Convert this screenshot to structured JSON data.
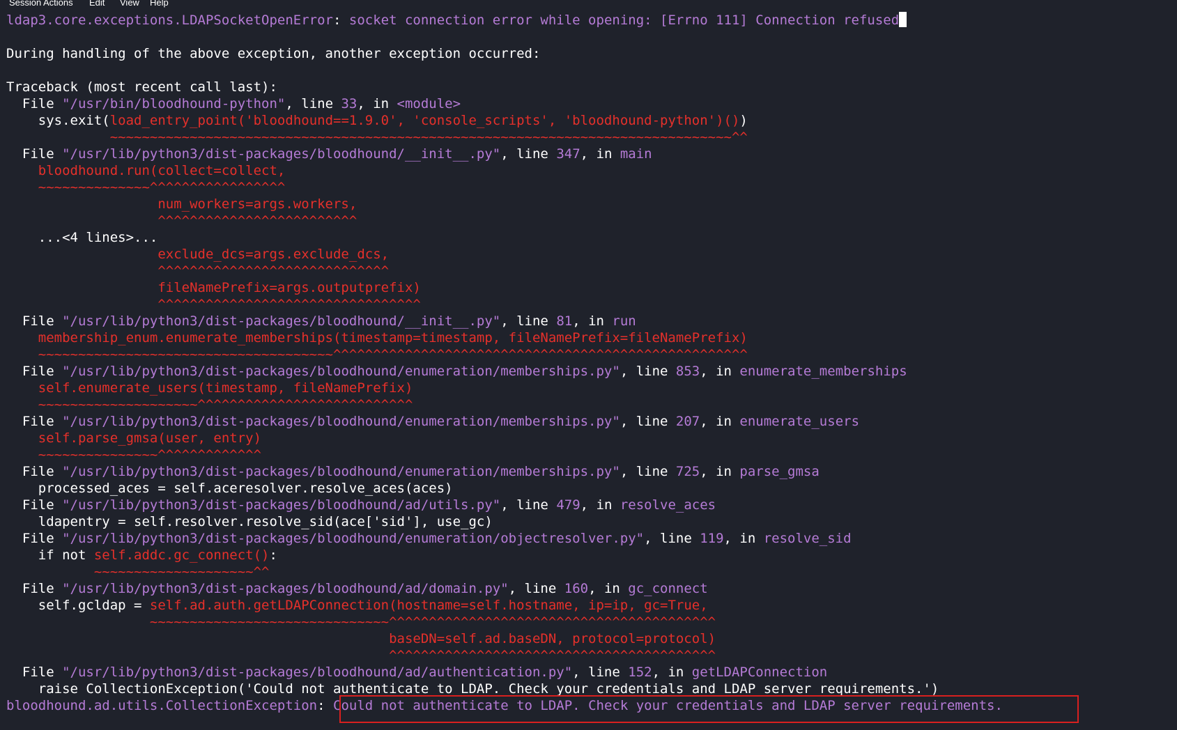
{
  "menubar": {
    "items": [
      "Session",
      "Actions",
      "Edit",
      "View",
      "Help"
    ]
  },
  "lines": [
    [
      [
        "p",
        "ldap3.core.exceptions.LDAPSocketOpenError"
      ],
      [
        "w",
        ": "
      ],
      [
        "p",
        "socket connection error while opening: [Errno 111] Connection refused"
      ]
    ],
    [],
    [
      [
        "w",
        "During handling of the above exception, another exception occurred:"
      ]
    ],
    [],
    [
      [
        "w",
        "Traceback (most recent call last):"
      ]
    ],
    [
      [
        "w",
        "  File "
      ],
      [
        "p",
        "\"/usr/bin/bloodhound-python\""
      ],
      [
        "w",
        ", line "
      ],
      [
        "p",
        "33"
      ],
      [
        "w",
        ", in "
      ],
      [
        "p",
        "<module>"
      ]
    ],
    [
      [
        "w",
        "    sys.exit("
      ],
      [
        "r",
        "load_entry_point('bloodhound==1.9.0', 'console_scripts', 'bloodhound-python')()"
      ],
      [
        "w",
        ")"
      ]
    ],
    [
      [
        "r",
        "             ~~~~~~~~~~~~~~~~~~~~~~~~~~~~~~~~~~~~~~~~~~~~~~~~~~~~~~~~~~~~~~~~~~~~~~~~~~~~~~^^"
      ]
    ],
    [
      [
        "w",
        "  File "
      ],
      [
        "p",
        "\"/usr/lib/python3/dist-packages/bloodhound/__init__.py\""
      ],
      [
        "w",
        ", line "
      ],
      [
        "p",
        "347"
      ],
      [
        "w",
        ", in "
      ],
      [
        "p",
        "main"
      ]
    ],
    [
      [
        "r",
        "    bloodhound.run(collect=collect,"
      ]
    ],
    [
      [
        "r",
        "    ~~~~~~~~~~~~~~^^^^^^^^^^^^^^^^^"
      ]
    ],
    [
      [
        "r",
        "                   num_workers=args.workers,"
      ]
    ],
    [
      [
        "r",
        "                   ^^^^^^^^^^^^^^^^^^^^^^^^^"
      ]
    ],
    [
      [
        "w",
        "    ...<4 lines>..."
      ]
    ],
    [
      [
        "r",
        "                   exclude_dcs=args.exclude_dcs,"
      ]
    ],
    [
      [
        "r",
        "                   ^^^^^^^^^^^^^^^^^^^^^^^^^^^^^"
      ]
    ],
    [
      [
        "r",
        "                   fileNamePrefix=args.outputprefix)"
      ]
    ],
    [
      [
        "r",
        "                   ^^^^^^^^^^^^^^^^^^^^^^^^^^^^^^^^^"
      ]
    ],
    [
      [
        "w",
        "  File "
      ],
      [
        "p",
        "\"/usr/lib/python3/dist-packages/bloodhound/__init__.py\""
      ],
      [
        "w",
        ", line "
      ],
      [
        "p",
        "81"
      ],
      [
        "w",
        ", in "
      ],
      [
        "p",
        "run"
      ]
    ],
    [
      [
        "r",
        "    membership_enum.enumerate_memberships(timestamp=timestamp, fileNamePrefix=fileNamePrefix)"
      ]
    ],
    [
      [
        "r",
        "    ~~~~~~~~~~~~~~~~~~~~~~~~~~~~~~~~~~~~~^^^^^^^^^^^^^^^^^^^^^^^^^^^^^^^^^^^^^^^^^^^^^^^^^^^^"
      ]
    ],
    [
      [
        "w",
        "  File "
      ],
      [
        "p",
        "\"/usr/lib/python3/dist-packages/bloodhound/enumeration/memberships.py\""
      ],
      [
        "w",
        ", line "
      ],
      [
        "p",
        "853"
      ],
      [
        "w",
        ", in "
      ],
      [
        "p",
        "enumerate_memberships"
      ]
    ],
    [
      [
        "r",
        "    self.enumerate_users(timestamp, fileNamePrefix)"
      ]
    ],
    [
      [
        "r",
        "    ~~~~~~~~~~~~~~~~~~~~^^^^^^^^^^^^^^^^^^^^^^^^^^^"
      ]
    ],
    [
      [
        "w",
        "  File "
      ],
      [
        "p",
        "\"/usr/lib/python3/dist-packages/bloodhound/enumeration/memberships.py\""
      ],
      [
        "w",
        ", line "
      ],
      [
        "p",
        "207"
      ],
      [
        "w",
        ", in "
      ],
      [
        "p",
        "enumerate_users"
      ]
    ],
    [
      [
        "r",
        "    self.parse_gmsa(user, entry)"
      ]
    ],
    [
      [
        "r",
        "    ~~~~~~~~~~~~~~~^^^^^^^^^^^^^"
      ]
    ],
    [
      [
        "w",
        "  File "
      ],
      [
        "p",
        "\"/usr/lib/python3/dist-packages/bloodhound/enumeration/memberships.py\""
      ],
      [
        "w",
        ", line "
      ],
      [
        "p",
        "725"
      ],
      [
        "w",
        ", in "
      ],
      [
        "p",
        "parse_gmsa"
      ]
    ],
    [
      [
        "w",
        "    processed_aces = self.aceresolver.resolve_aces(aces)"
      ]
    ],
    [
      [
        "w",
        "  File "
      ],
      [
        "p",
        "\"/usr/lib/python3/dist-packages/bloodhound/ad/utils.py\""
      ],
      [
        "w",
        ", line "
      ],
      [
        "p",
        "479"
      ],
      [
        "w",
        ", in "
      ],
      [
        "p",
        "resolve_aces"
      ]
    ],
    [
      [
        "w",
        "    ldapentry = self.resolver.resolve_sid(ace['sid'], use_gc)"
      ]
    ],
    [
      [
        "w",
        "  File "
      ],
      [
        "p",
        "\"/usr/lib/python3/dist-packages/bloodhound/enumeration/objectresolver.py\""
      ],
      [
        "w",
        ", line "
      ],
      [
        "p",
        "119"
      ],
      [
        "w",
        ", in "
      ],
      [
        "p",
        "resolve_sid"
      ]
    ],
    [
      [
        "w",
        "    if not "
      ],
      [
        "r",
        "self.addc.gc_connect()"
      ],
      [
        "w",
        ":"
      ]
    ],
    [
      [
        "r",
        "           ~~~~~~~~~~~~~~~~~~~~^^"
      ]
    ],
    [
      [
        "w",
        "  File "
      ],
      [
        "p",
        "\"/usr/lib/python3/dist-packages/bloodhound/ad/domain.py\""
      ],
      [
        "w",
        ", line "
      ],
      [
        "p",
        "160"
      ],
      [
        "w",
        ", in "
      ],
      [
        "p",
        "gc_connect"
      ]
    ],
    [
      [
        "w",
        "    self.gcldap = "
      ],
      [
        "r",
        "self.ad.auth.getLDAPConnection(hostname=self.hostname, ip=ip, gc=True,"
      ]
    ],
    [
      [
        "r",
        "                  ~~~~~~~~~~~~~~~~~~~~~~~~~~~~~~^^^^^^^^^^^^^^^^^^^^^^^^^^^^^^^^^^^^^^^^^"
      ]
    ],
    [
      [
        "r",
        "                                                baseDN=self.ad.baseDN, protocol=protocol)"
      ]
    ],
    [
      [
        "r",
        "                                                ^^^^^^^^^^^^^^^^^^^^^^^^^^^^^^^^^^^^^^^^^"
      ]
    ],
    [
      [
        "w",
        "  File "
      ],
      [
        "p",
        "\"/usr/lib/python3/dist-packages/bloodhound/ad/authentication.py\""
      ],
      [
        "w",
        ", line "
      ],
      [
        "p",
        "152"
      ],
      [
        "w",
        ", in "
      ],
      [
        "p",
        "getLDAPConnection"
      ]
    ],
    [
      [
        "w",
        "    raise CollectionException('Could not authenticate to LDAP. Check your credentials and LDAP server requirements.')"
      ]
    ],
    [
      [
        "p",
        "bloodhound.ad.utils.CollectionException"
      ],
      [
        "w",
        ": "
      ],
      [
        "p",
        "Could not authenticate to LDAP. Check your credentials and LDAP server requirements."
      ]
    ]
  ]
}
